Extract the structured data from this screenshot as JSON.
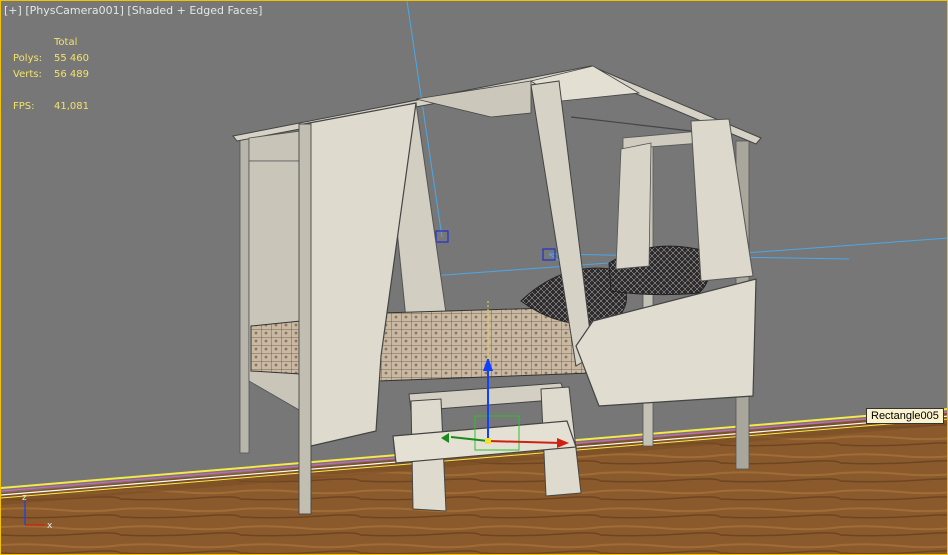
{
  "viewport": {
    "menu_label": "[+]",
    "camera_label": "[PhysCamera001]",
    "shading_label": "[Shaded + Edged Faces]"
  },
  "stats": {
    "header": "Total",
    "polys_label": "Polys:",
    "polys_value": "55 460",
    "verts_label": "Verts:",
    "verts_value": "56 489",
    "fps_label": "FPS:",
    "fps_value": "41,081"
  },
  "selection": {
    "object_name": "Rectangle005"
  },
  "axis_tripod": {
    "z_label": "z",
    "x_label": "x"
  },
  "colors": {
    "viewport_border": "#f2c200",
    "stats_text": "#f3e36a",
    "wall": "#767676",
    "floor": "#8a5a2c",
    "furniture": "#dcd9cc"
  }
}
